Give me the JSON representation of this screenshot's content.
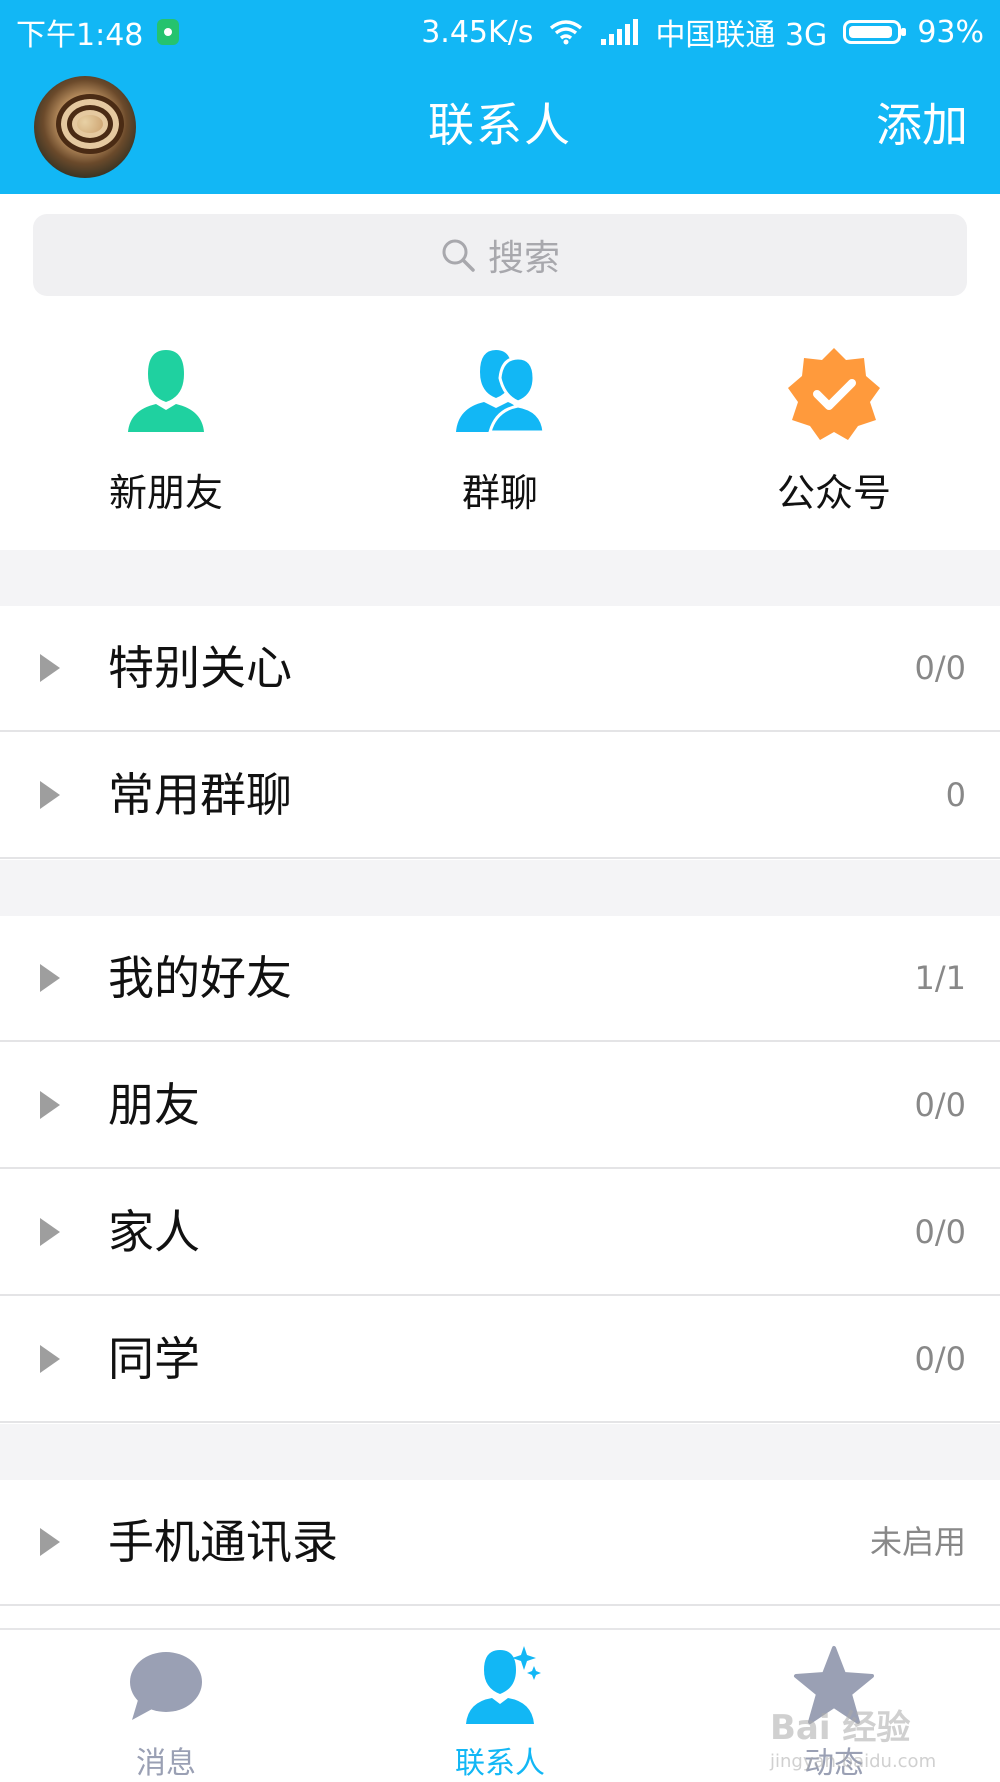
{
  "status": {
    "time": "下午1:48",
    "speed": "3.45K/s",
    "carrier": "中国联通 3G",
    "battery": "93%"
  },
  "header": {
    "title": "联系人",
    "add_label": "添加"
  },
  "search": {
    "placeholder": "搜索"
  },
  "quick_actions": [
    {
      "label": "新朋友",
      "icon": "person-icon",
      "color": "#1fd1a0"
    },
    {
      "label": "群聊",
      "icon": "group-icon",
      "color": "#12b7f5"
    },
    {
      "label": "公众号",
      "icon": "verified-badge-icon",
      "color": "#ff9a3c"
    }
  ],
  "groups": [
    {
      "name": "特别关心",
      "count": "0/0"
    },
    {
      "name": "常用群聊",
      "count": "0"
    },
    {
      "name": "我的好友",
      "count": "1/1"
    },
    {
      "name": "朋友",
      "count": "0/0"
    },
    {
      "name": "家人",
      "count": "0/0"
    },
    {
      "name": "同学",
      "count": "0/0"
    },
    {
      "name": "手机通讯录",
      "count": "未启用"
    }
  ],
  "tabs": [
    {
      "label": "消息",
      "icon": "chat-bubble-icon",
      "active": false
    },
    {
      "label": "联系人",
      "icon": "contacts-icon",
      "active": true
    },
    {
      "label": "动态",
      "icon": "star-icon",
      "active": false
    }
  ],
  "watermark": {
    "text": "Bai 经验",
    "sub": "jingyan.baidu.com"
  },
  "colors": {
    "accent": "#12b7f5",
    "inactive_tab": "#9aa0b4"
  }
}
